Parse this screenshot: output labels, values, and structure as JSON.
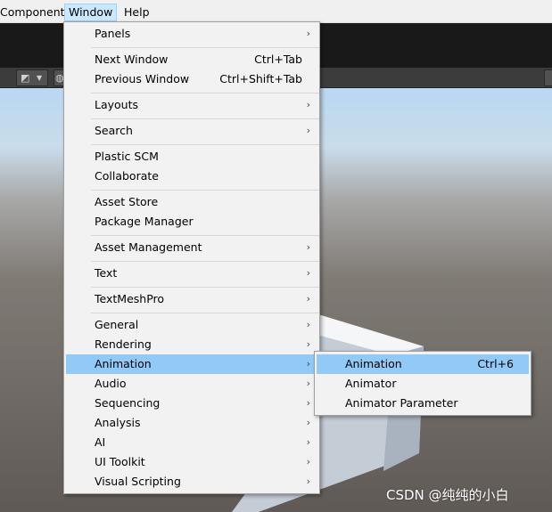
{
  "menubar": {
    "component": "Component",
    "window": "Window",
    "help": "Help"
  },
  "window_menu": {
    "panels": "Panels",
    "next_window": "Next Window",
    "next_window_sc": "Ctrl+Tab",
    "previous_window": "Previous Window",
    "previous_window_sc": "Ctrl+Shift+Tab",
    "layouts": "Layouts",
    "search": "Search",
    "plastic_scm": "Plastic SCM",
    "collaborate": "Collaborate",
    "asset_store": "Asset Store",
    "package_manager": "Package Manager",
    "asset_management": "Asset Management",
    "text": "Text",
    "textmeshpro": "TextMeshPro",
    "general": "General",
    "rendering": "Rendering",
    "animation": "Animation",
    "audio": "Audio",
    "sequencing": "Sequencing",
    "analysis": "Analysis",
    "ai": "AI",
    "ui_toolkit": "UI Toolkit",
    "visual_scripting": "Visual Scripting"
  },
  "animation_submenu": {
    "animation": "Animation",
    "animation_sc": "Ctrl+6",
    "animator": "Animator",
    "animator_parameter": "Animator Parameter"
  },
  "watermark": "CSDN @纯纯的小白",
  "icons": {
    "submenu_arrow": "›"
  },
  "colors": {
    "highlight": "#91c9f7",
    "menu_bg": "#f2f2f2",
    "menubar_active": "#cce8ff"
  }
}
